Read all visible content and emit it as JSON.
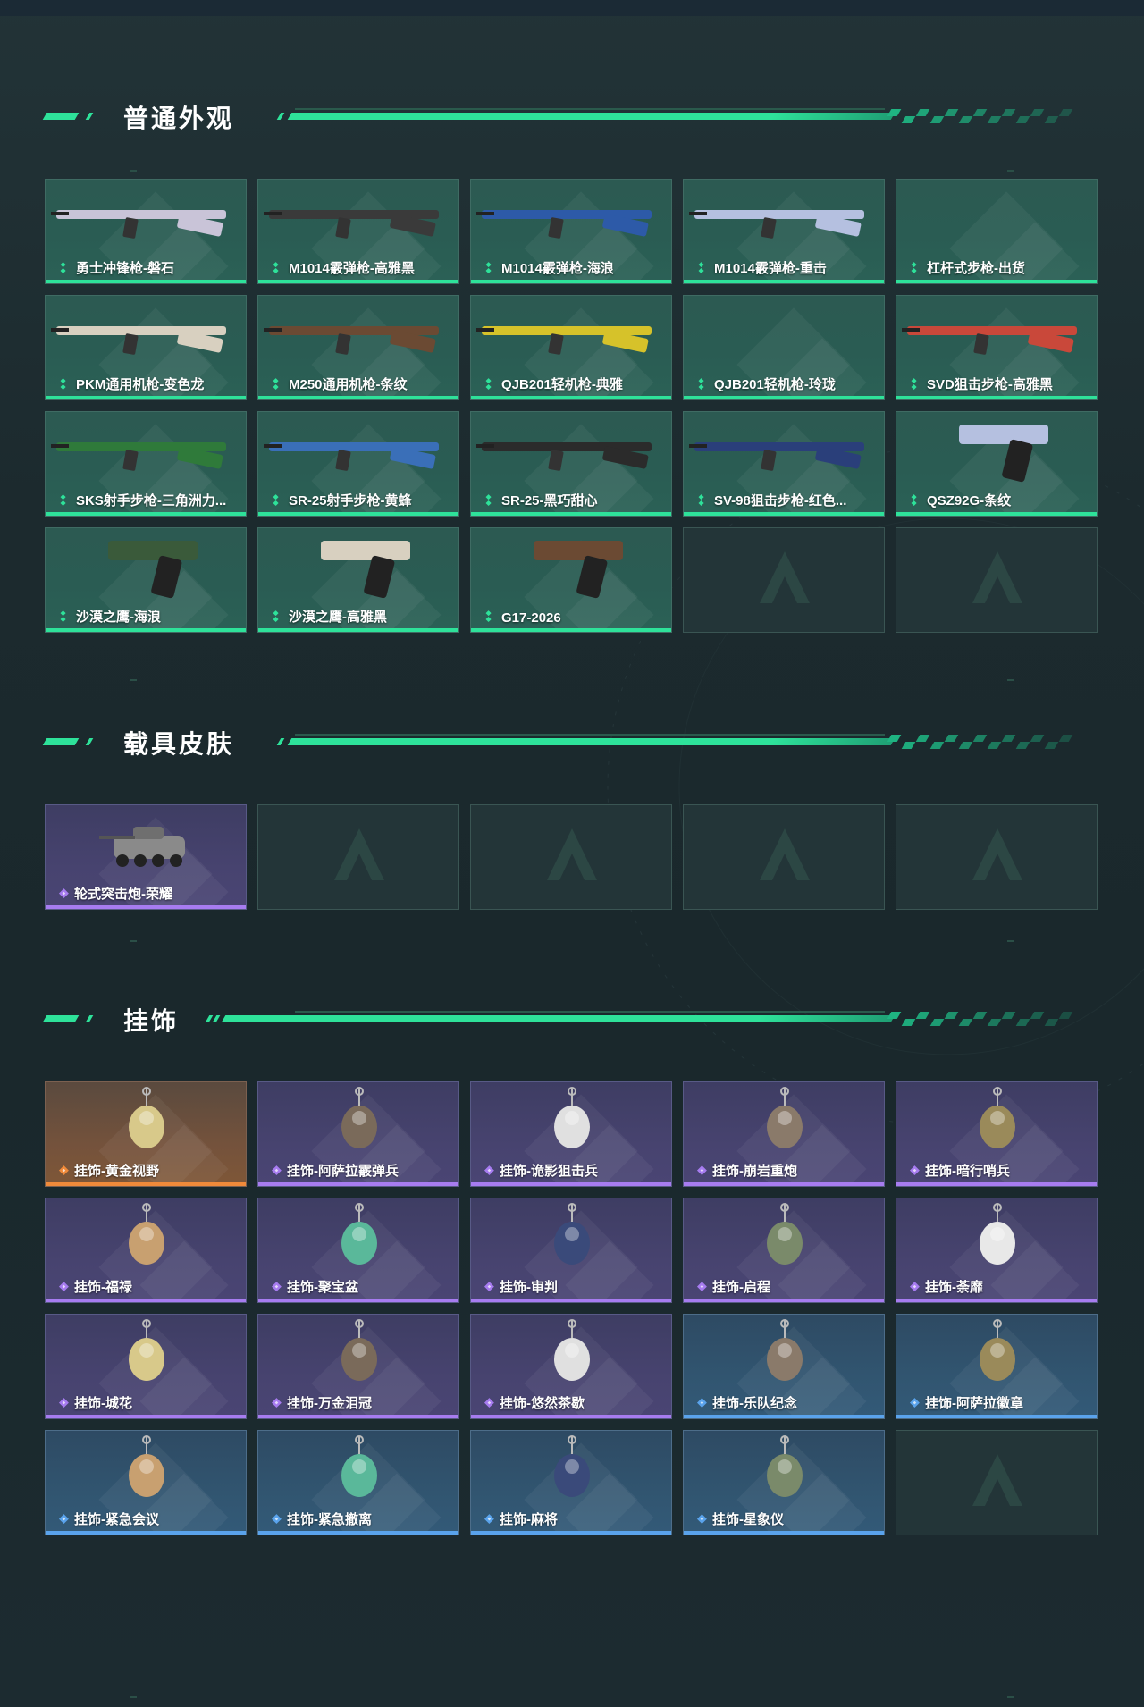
{
  "sections": {
    "weapons": {
      "title": "普通外观",
      "items": [
        {
          "label": "勇士冲锋枪-磐石",
          "rarity": "green",
          "icon": "smg-icon"
        },
        {
          "label": "M1014霰弹枪-高雅黑",
          "rarity": "green",
          "icon": "shotgun-icon"
        },
        {
          "label": "M1014霰弹枪-海浪",
          "rarity": "green",
          "icon": "shotgun-icon"
        },
        {
          "label": "M1014霰弹枪-重击",
          "rarity": "green",
          "icon": "shotgun-icon"
        },
        {
          "label": "杠杆式步枪-出货",
          "rarity": "green",
          "icon": ""
        },
        {
          "label": "PKM通用机枪-变色龙",
          "rarity": "green",
          "icon": "machine-gun-icon"
        },
        {
          "label": "M250通用机枪-条纹",
          "rarity": "green",
          "icon": "machine-gun-icon"
        },
        {
          "label": "QJB201轻机枪-典雅",
          "rarity": "green",
          "icon": "machine-gun-icon"
        },
        {
          "label": "QJB201轻机枪-玲珑",
          "rarity": "green",
          "icon": ""
        },
        {
          "label": "SVD狙击步枪-高雅黑",
          "rarity": "green",
          "icon": "sniper-rifle-icon"
        },
        {
          "label": "SKS射手步枪-三角洲力...",
          "rarity": "green",
          "icon": "rifle-icon"
        },
        {
          "label": "SR-25射手步枪-黄蜂",
          "rarity": "green",
          "icon": "rifle-icon"
        },
        {
          "label": "SR-25-黑巧甜心",
          "rarity": "green",
          "icon": "rifle-icon"
        },
        {
          "label": "SV-98狙击步枪-红色...",
          "rarity": "green",
          "icon": "sniper-rifle-icon"
        },
        {
          "label": "QSZ92G-条纹",
          "rarity": "green",
          "icon": "pistol-icon"
        },
        {
          "label": "沙漠之鹰-海浪",
          "rarity": "green",
          "icon": "pistol-icon"
        },
        {
          "label": "沙漠之鹰-高雅黑",
          "rarity": "green",
          "icon": "pistol-icon"
        },
        {
          "label": "G17-2026",
          "rarity": "green",
          "icon": "pistol-icon"
        },
        {
          "label": "",
          "rarity": "empty",
          "icon": "placeholder-logo-icon"
        },
        {
          "label": "",
          "rarity": "empty",
          "icon": "placeholder-logo-icon"
        }
      ]
    },
    "vehicles": {
      "title": "载具皮肤",
      "items": [
        {
          "label": "轮式突击炮-荣耀",
          "rarity": "purple",
          "icon": "vehicle-icon"
        },
        {
          "label": "",
          "rarity": "empty",
          "icon": "placeholder-logo-icon"
        },
        {
          "label": "",
          "rarity": "empty",
          "icon": "placeholder-logo-icon"
        },
        {
          "label": "",
          "rarity": "empty",
          "icon": "placeholder-logo-icon"
        },
        {
          "label": "",
          "rarity": "empty",
          "icon": "placeholder-logo-icon"
        }
      ]
    },
    "charms": {
      "title": "挂饰",
      "items": [
        {
          "label": "挂饰-黄金视野",
          "rarity": "orange",
          "icon": "charm-icon"
        },
        {
          "label": "挂饰-阿萨拉霰弹兵",
          "rarity": "purple",
          "icon": "charm-icon"
        },
        {
          "label": "挂饰-诡影狙击兵",
          "rarity": "purple",
          "icon": "charm-icon"
        },
        {
          "label": "挂饰-崩岩重炮",
          "rarity": "purple",
          "icon": "charm-icon"
        },
        {
          "label": "挂饰-暗行哨兵",
          "rarity": "purple",
          "icon": "charm-icon"
        },
        {
          "label": "挂饰-福禄",
          "rarity": "purple",
          "icon": "charm-icon"
        },
        {
          "label": "挂饰-聚宝盆",
          "rarity": "purple",
          "icon": "charm-icon"
        },
        {
          "label": "挂饰-审判",
          "rarity": "purple",
          "icon": "charm-icon"
        },
        {
          "label": "挂饰-启程",
          "rarity": "purple",
          "icon": "charm-icon"
        },
        {
          "label": "挂饰-荼靡",
          "rarity": "purple",
          "icon": "charm-icon"
        },
        {
          "label": "挂饰-城花",
          "rarity": "purple",
          "icon": "charm-icon"
        },
        {
          "label": "挂饰-万金泪冠",
          "rarity": "purple",
          "icon": "charm-icon"
        },
        {
          "label": "挂饰-悠然茶歇",
          "rarity": "purple",
          "icon": "charm-icon"
        },
        {
          "label": "挂饰-乐队纪念",
          "rarity": "blue",
          "icon": "charm-icon"
        },
        {
          "label": "挂饰-阿萨拉徽章",
          "rarity": "blue",
          "icon": "charm-icon"
        },
        {
          "label": "挂饰-紧急会议",
          "rarity": "blue",
          "icon": "charm-icon"
        },
        {
          "label": "挂饰-紧急撤离",
          "rarity": "blue",
          "icon": "charm-icon"
        },
        {
          "label": "挂饰-麻将",
          "rarity": "blue",
          "icon": "charm-icon"
        },
        {
          "label": "挂饰-星象仪",
          "rarity": "blue",
          "icon": "charm-icon"
        },
        {
          "label": "",
          "rarity": "empty",
          "icon": "placeholder-logo-icon"
        }
      ]
    }
  },
  "colors": {
    "accent": "#2ee29a",
    "green": "#2ee29a",
    "purple": "#a77cf0",
    "orange": "#f08a3a",
    "blue": "#5aa3ec"
  }
}
